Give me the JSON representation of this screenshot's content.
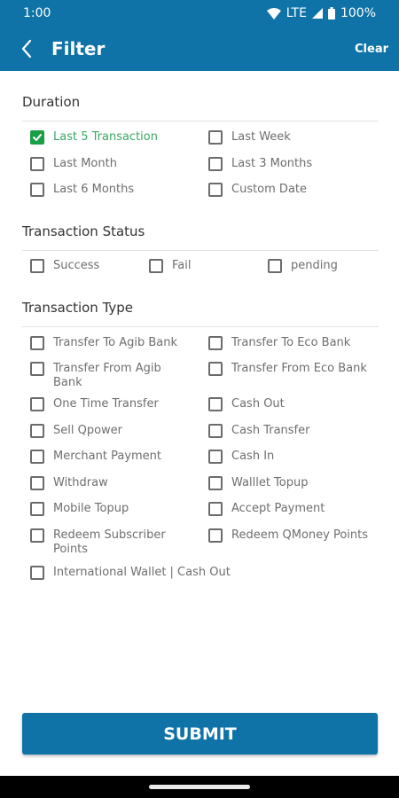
{
  "status_bar": {
    "time": "1:00",
    "network": "LTE",
    "battery": "100%"
  },
  "header": {
    "title": "Filter",
    "clear_label": "Clear"
  },
  "sections": {
    "duration": {
      "title": "Duration",
      "options": [
        {
          "label": "Last 5 Transaction",
          "checked": true
        },
        {
          "label": "Last Week",
          "checked": false
        },
        {
          "label": "Last Month",
          "checked": false
        },
        {
          "label": "Last 3 Months",
          "checked": false
        },
        {
          "label": "Last 6 Months",
          "checked": false
        },
        {
          "label": "Custom Date",
          "checked": false
        }
      ]
    },
    "status": {
      "title": "Transaction Status",
      "options": [
        {
          "label": "Success",
          "checked": false
        },
        {
          "label": "Fail",
          "checked": false
        },
        {
          "label": "pending",
          "checked": false
        }
      ]
    },
    "type": {
      "title": "Transaction Type",
      "options": [
        {
          "label": "Transfer To Agib Bank",
          "checked": false
        },
        {
          "label": "Transfer To Eco Bank",
          "checked": false
        },
        {
          "label": "Transfer From Agib Bank",
          "checked": false
        },
        {
          "label": "Transfer From Eco Bank",
          "checked": false
        },
        {
          "label": "One Time Transfer",
          "checked": false
        },
        {
          "label": "Cash Out",
          "checked": false
        },
        {
          "label": "Sell Qpower",
          "checked": false
        },
        {
          "label": "Cash Transfer",
          "checked": false
        },
        {
          "label": "Merchant Payment",
          "checked": false
        },
        {
          "label": "Cash In",
          "checked": false
        },
        {
          "label": "Withdraw",
          "checked": false
        },
        {
          "label": "Walllet Topup",
          "checked": false
        },
        {
          "label": "Mobile Topup",
          "checked": false
        },
        {
          "label": "Accept Payment",
          "checked": false
        },
        {
          "label": "Redeem Subscriber Points",
          "checked": false
        },
        {
          "label": "Redeem QMoney Points",
          "checked": false
        },
        {
          "label": "International Wallet | Cash Out",
          "checked": false
        }
      ]
    }
  },
  "submit_label": "SUBMIT",
  "colors": {
    "primary": "#0f73a8",
    "accent_green": "#1a9e46"
  }
}
